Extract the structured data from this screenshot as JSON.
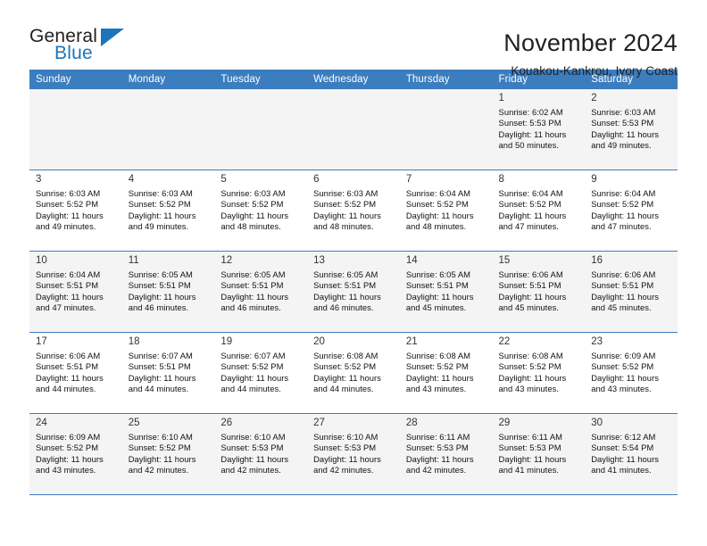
{
  "brand": {
    "name_part1": "General",
    "name_part2": "Blue",
    "triangle_color": "#1b75bb"
  },
  "header": {
    "title": "November 2024",
    "subtitle": "Kouakou-Kankrou, Ivory Coast"
  },
  "theme": {
    "header_band": "#3b7dbf",
    "row_shade": "#f4f4f4",
    "text": "#231f20"
  },
  "weekdays": [
    "Sunday",
    "Monday",
    "Tuesday",
    "Wednesday",
    "Thursday",
    "Friday",
    "Saturday"
  ],
  "labels": {
    "sunrise_prefix": "Sunrise:",
    "sunset_prefix": "Sunset:",
    "daylight_prefix": "Daylight:"
  },
  "weeks": [
    {
      "shaded": true,
      "days": [
        {
          "empty": true
        },
        {
          "empty": true
        },
        {
          "empty": true
        },
        {
          "empty": true
        },
        {
          "empty": true
        },
        {
          "day": "1",
          "line1": "Sunrise: 6:02 AM",
          "line2": "Sunset: 5:53 PM",
          "line3": "Daylight: 11 hours",
          "line4": "and 50 minutes."
        },
        {
          "day": "2",
          "line1": "Sunrise: 6:03 AM",
          "line2": "Sunset: 5:53 PM",
          "line3": "Daylight: 11 hours",
          "line4": "and 49 minutes."
        }
      ]
    },
    {
      "shaded": false,
      "days": [
        {
          "day": "3",
          "line1": "Sunrise: 6:03 AM",
          "line2": "Sunset: 5:52 PM",
          "line3": "Daylight: 11 hours",
          "line4": "and 49 minutes."
        },
        {
          "day": "4",
          "line1": "Sunrise: 6:03 AM",
          "line2": "Sunset: 5:52 PM",
          "line3": "Daylight: 11 hours",
          "line4": "and 49 minutes."
        },
        {
          "day": "5",
          "line1": "Sunrise: 6:03 AM",
          "line2": "Sunset: 5:52 PM",
          "line3": "Daylight: 11 hours",
          "line4": "and 48 minutes."
        },
        {
          "day": "6",
          "line1": "Sunrise: 6:03 AM",
          "line2": "Sunset: 5:52 PM",
          "line3": "Daylight: 11 hours",
          "line4": "and 48 minutes."
        },
        {
          "day": "7",
          "line1": "Sunrise: 6:04 AM",
          "line2": "Sunset: 5:52 PM",
          "line3": "Daylight: 11 hours",
          "line4": "and 48 minutes."
        },
        {
          "day": "8",
          "line1": "Sunrise: 6:04 AM",
          "line2": "Sunset: 5:52 PM",
          "line3": "Daylight: 11 hours",
          "line4": "and 47 minutes."
        },
        {
          "day": "9",
          "line1": "Sunrise: 6:04 AM",
          "line2": "Sunset: 5:52 PM",
          "line3": "Daylight: 11 hours",
          "line4": "and 47 minutes."
        }
      ]
    },
    {
      "shaded": true,
      "days": [
        {
          "day": "10",
          "line1": "Sunrise: 6:04 AM",
          "line2": "Sunset: 5:51 PM",
          "line3": "Daylight: 11 hours",
          "line4": "and 47 minutes."
        },
        {
          "day": "11",
          "line1": "Sunrise: 6:05 AM",
          "line2": "Sunset: 5:51 PM",
          "line3": "Daylight: 11 hours",
          "line4": "and 46 minutes."
        },
        {
          "day": "12",
          "line1": "Sunrise: 6:05 AM",
          "line2": "Sunset: 5:51 PM",
          "line3": "Daylight: 11 hours",
          "line4": "and 46 minutes."
        },
        {
          "day": "13",
          "line1": "Sunrise: 6:05 AM",
          "line2": "Sunset: 5:51 PM",
          "line3": "Daylight: 11 hours",
          "line4": "and 46 minutes."
        },
        {
          "day": "14",
          "line1": "Sunrise: 6:05 AM",
          "line2": "Sunset: 5:51 PM",
          "line3": "Daylight: 11 hours",
          "line4": "and 45 minutes."
        },
        {
          "day": "15",
          "line1": "Sunrise: 6:06 AM",
          "line2": "Sunset: 5:51 PM",
          "line3": "Daylight: 11 hours",
          "line4": "and 45 minutes."
        },
        {
          "day": "16",
          "line1": "Sunrise: 6:06 AM",
          "line2": "Sunset: 5:51 PM",
          "line3": "Daylight: 11 hours",
          "line4": "and 45 minutes."
        }
      ]
    },
    {
      "shaded": false,
      "days": [
        {
          "day": "17",
          "line1": "Sunrise: 6:06 AM",
          "line2": "Sunset: 5:51 PM",
          "line3": "Daylight: 11 hours",
          "line4": "and 44 minutes."
        },
        {
          "day": "18",
          "line1": "Sunrise: 6:07 AM",
          "line2": "Sunset: 5:51 PM",
          "line3": "Daylight: 11 hours",
          "line4": "and 44 minutes."
        },
        {
          "day": "19",
          "line1": "Sunrise: 6:07 AM",
          "line2": "Sunset: 5:52 PM",
          "line3": "Daylight: 11 hours",
          "line4": "and 44 minutes."
        },
        {
          "day": "20",
          "line1": "Sunrise: 6:08 AM",
          "line2": "Sunset: 5:52 PM",
          "line3": "Daylight: 11 hours",
          "line4": "and 44 minutes."
        },
        {
          "day": "21",
          "line1": "Sunrise: 6:08 AM",
          "line2": "Sunset: 5:52 PM",
          "line3": "Daylight: 11 hours",
          "line4": "and 43 minutes."
        },
        {
          "day": "22",
          "line1": "Sunrise: 6:08 AM",
          "line2": "Sunset: 5:52 PM",
          "line3": "Daylight: 11 hours",
          "line4": "and 43 minutes."
        },
        {
          "day": "23",
          "line1": "Sunrise: 6:09 AM",
          "line2": "Sunset: 5:52 PM",
          "line3": "Daylight: 11 hours",
          "line4": "and 43 minutes."
        }
      ]
    },
    {
      "shaded": true,
      "days": [
        {
          "day": "24",
          "line1": "Sunrise: 6:09 AM",
          "line2": "Sunset: 5:52 PM",
          "line3": "Daylight: 11 hours",
          "line4": "and 43 minutes."
        },
        {
          "day": "25",
          "line1": "Sunrise: 6:10 AM",
          "line2": "Sunset: 5:52 PM",
          "line3": "Daylight: 11 hours",
          "line4": "and 42 minutes."
        },
        {
          "day": "26",
          "line1": "Sunrise: 6:10 AM",
          "line2": "Sunset: 5:53 PM",
          "line3": "Daylight: 11 hours",
          "line4": "and 42 minutes."
        },
        {
          "day": "27",
          "line1": "Sunrise: 6:10 AM",
          "line2": "Sunset: 5:53 PM",
          "line3": "Daylight: 11 hours",
          "line4": "and 42 minutes."
        },
        {
          "day": "28",
          "line1": "Sunrise: 6:11 AM",
          "line2": "Sunset: 5:53 PM",
          "line3": "Daylight: 11 hours",
          "line4": "and 42 minutes."
        },
        {
          "day": "29",
          "line1": "Sunrise: 6:11 AM",
          "line2": "Sunset: 5:53 PM",
          "line3": "Daylight: 11 hours",
          "line4": "and 41 minutes."
        },
        {
          "day": "30",
          "line1": "Sunrise: 6:12 AM",
          "line2": "Sunset: 5:54 PM",
          "line3": "Daylight: 11 hours",
          "line4": "and 41 minutes."
        }
      ]
    }
  ]
}
